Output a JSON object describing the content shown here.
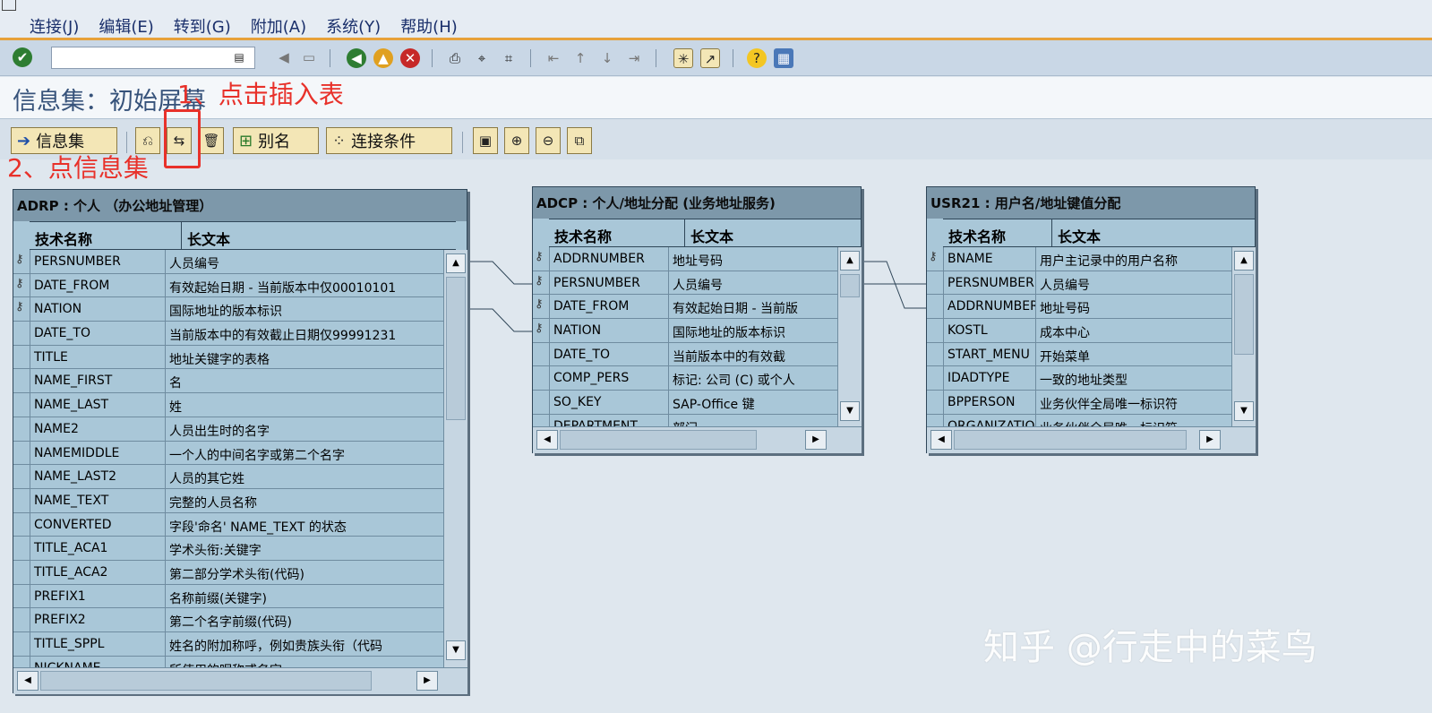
{
  "menu": {
    "items": [
      "连接(J)",
      "编辑(E)",
      "转到(G)",
      "附加(A)",
      "系统(Y)",
      "帮助(H)"
    ]
  },
  "std_toolbar": {
    "command_value": ""
  },
  "title": "信息集：初始屏幕",
  "app_toolbar": {
    "infoset_label": "信息集",
    "alias_label": "别名",
    "join_label": "连接条件"
  },
  "annotations": {
    "step1": "1、点击插入表",
    "step2": "2、点信息集"
  },
  "tables": {
    "adrp": {
      "title": "ADRP : 个人 （办公地址管理）",
      "col1": "技术名称",
      "col2": "长文本",
      "rows": [
        [
          "PERSNUMBER",
          "人员编号",
          true
        ],
        [
          "DATE_FROM",
          "有效起始日期 - 当前版本中仅00010101",
          true
        ],
        [
          "NATION",
          "国际地址的版本标识",
          true
        ],
        [
          "DATE_TO",
          "当前版本中的有效截止日期仅99991231",
          false
        ],
        [
          "TITLE",
          "地址关键字的表格",
          false
        ],
        [
          "NAME_FIRST",
          "名",
          false
        ],
        [
          "NAME_LAST",
          "姓",
          false
        ],
        [
          "NAME2",
          "人员出生时的名字",
          false
        ],
        [
          "NAMEMIDDLE",
          "一个人的中间名字或第二个名字",
          false
        ],
        [
          "NAME_LAST2",
          "人员的其它姓",
          false
        ],
        [
          "NAME_TEXT",
          "完整的人员名称",
          false
        ],
        [
          "CONVERTED",
          "字段'命名' NAME_TEXT 的状态",
          false
        ],
        [
          "TITLE_ACA1",
          "学术头衔:关键字",
          false
        ],
        [
          "TITLE_ACA2",
          "第二部分学术头衔(代码)",
          false
        ],
        [
          "PREFIX1",
          "名称前缀(关键字)",
          false
        ],
        [
          "PREFIX2",
          "第二个名字前缀(代码)",
          false
        ],
        [
          "TITLE_SPPL",
          "姓名的附加称呼，例如贵族头衔（代码",
          false
        ],
        [
          "NICKNAME",
          "所使用的昵称或名字",
          false
        ]
      ]
    },
    "adcp": {
      "title": "ADCP : 个人/地址分配 (业务地址服务)",
      "col1": "技术名称",
      "col2": "长文本",
      "rows": [
        [
          "ADDRNUMBER",
          "地址号码",
          true
        ],
        [
          "PERSNUMBER",
          "人员编号",
          true
        ],
        [
          "DATE_FROM",
          "有效起始日期 - 当前版",
          true
        ],
        [
          "NATION",
          "国际地址的版本标识",
          true
        ],
        [
          "DATE_TO",
          "当前版本中的有效截",
          false
        ],
        [
          "COMP_PERS",
          "标记: 公司 (C) 或个人",
          false
        ],
        [
          "SO_KEY",
          "SAP-Office 键",
          false
        ],
        [
          "DEPARTMENT",
          "部门",
          false
        ]
      ]
    },
    "usr21": {
      "title": "USR21 : 用户名/地址键值分配",
      "col1": "技术名称",
      "col2": "长文本",
      "rows": [
        [
          "BNAME",
          "用户主记录中的用户名称",
          true
        ],
        [
          "PERSNUMBER",
          "人员编号",
          false
        ],
        [
          "ADDRNUMBER",
          "地址号码",
          false
        ],
        [
          "KOSTL",
          "成本中心",
          false
        ],
        [
          "START_MENU",
          "开始菜单",
          false
        ],
        [
          "IDADTYPE",
          "一致的地址类型",
          false
        ],
        [
          "BPPERSON",
          "业务伙伴全局唯一标识符",
          false
        ],
        [
          "ORGANIZATION",
          "业务伙伴全局唯一标识符",
          false
        ]
      ]
    }
  },
  "watermark": "知乎 @行走中的菜鸟"
}
